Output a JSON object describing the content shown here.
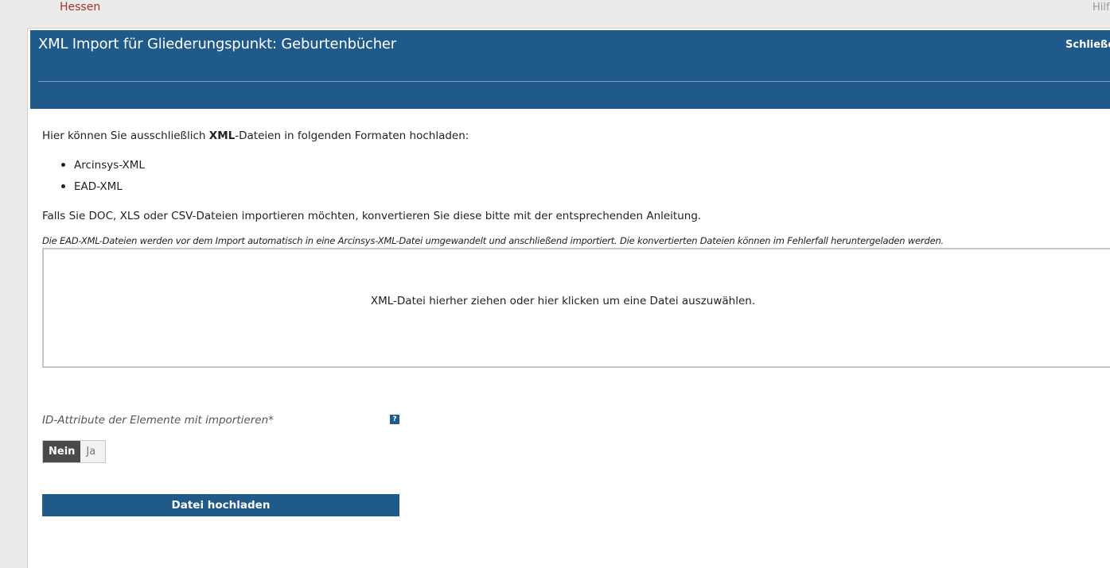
{
  "topbar": {
    "brand_link": "Hessen",
    "help_link": "Hilfe"
  },
  "dialog": {
    "title": "XML Import für Gliederungspunkt: Geburtenbücher",
    "close_label": "Schließen"
  },
  "content": {
    "intro_before": "Hier können Sie ausschließlich ",
    "intro_bold": "XML",
    "intro_after": "-Dateien in folgenden Formaten hochladen:",
    "formats": [
      "Arcinsys-XML",
      "EAD-XML"
    ],
    "hint": "Falls Sie DOC, XLS oder CSV-Dateien importieren möchten, konvertieren Sie diese bitte mit der entsprechenden Anleitung.",
    "note": "Die EAD-XML-Dateien werden vor dem Import automatisch in eine Arcinsys-XML-Datei umgewandelt und anschließend importiert. Die konvertierten Dateien können im Fehlerfall heruntergeladen werden.",
    "dropzone_text": "XML-Datei hierher ziehen oder hier klicken um eine Datei auszuwählen.",
    "id_attr_label": "ID-Attribute der Elemente mit importieren*",
    "help_icon_glyph": "?",
    "toggle": {
      "options": [
        "Nein",
        "Ja"
      ],
      "selected": "Nein"
    },
    "upload_button": "Datei hochladen"
  },
  "colors": {
    "header": "#1f5a8b",
    "topbar_link": "#a93226",
    "toggle_active": "#4a4a4a"
  }
}
